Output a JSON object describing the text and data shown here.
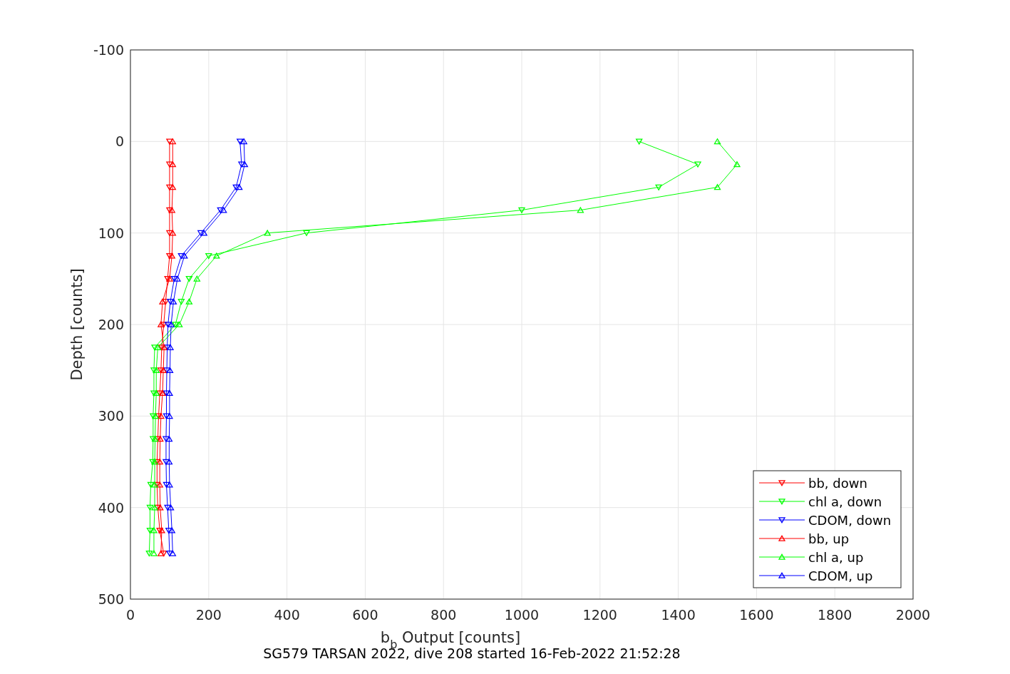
{
  "caption": "SG579 TARSAN 2022, dive 208 started 16-Feb-2022 21:52:28",
  "chart_data": {
    "type": "line",
    "orientation": "horizontal",
    "xlabel": "b$_{b}$ Output [counts]",
    "ylabel": "Depth [counts]",
    "x": [
      0,
      25,
      50,
      75,
      100,
      125,
      150,
      175,
      200,
      225,
      250,
      275,
      300,
      325,
      350,
      375,
      400,
      425,
      450
    ],
    "series": [
      {
        "name": "bb, down",
        "color": "#ff0000",
        "marker": "triangle-down",
        "values": [
          100,
          100,
          100,
          100,
          100,
          100,
          95,
          90,
          85,
          80,
          78,
          75,
          72,
          70,
          68,
          68,
          70,
          75,
          85
        ]
      },
      {
        "name": "chl a, down",
        "color": "#00ff00",
        "marker": "triangle-down",
        "values": [
          1300,
          1450,
          1350,
          1000,
          450,
          200,
          150,
          130,
          115,
          62,
          60,
          60,
          58,
          58,
          57,
          52,
          50,
          50,
          48
        ]
      },
      {
        "name": "CDOM, down",
        "color": "#0000ff",
        "marker": "triangle-down",
        "values": [
          280,
          284,
          270,
          230,
          180,
          130,
          112,
          102,
          96,
          94,
          93,
          92,
          92,
          91,
          91,
          92,
          95,
          98,
          100
        ]
      },
      {
        "name": "bb, up",
        "color": "#ff0000",
        "marker": "triangle-up",
        "values": [
          108,
          108,
          108,
          106,
          108,
          106,
          100,
          82,
          78,
          86,
          84,
          82,
          78,
          76,
          75,
          75,
          76,
          80,
          78
        ]
      },
      {
        "name": "chl a, up",
        "color": "#00ff00",
        "marker": "triangle-up",
        "values": [
          1500,
          1550,
          1500,
          1150,
          350,
          220,
          170,
          150,
          125,
          70,
          66,
          66,
          64,
          63,
          62,
          62,
          62,
          60,
          60
        ]
      },
      {
        "name": "CDOM, up",
        "color": "#0000ff",
        "marker": "triangle-up",
        "values": [
          290,
          292,
          278,
          238,
          188,
          138,
          120,
          110,
          104,
          102,
          101,
          100,
          100,
          99,
          99,
          100,
          103,
          106,
          108
        ]
      }
    ],
    "xlim": [
      0,
      2000
    ],
    "ylim": [
      500,
      -100
    ],
    "xticks": [
      0,
      200,
      400,
      600,
      800,
      1000,
      1200,
      1400,
      1600,
      1800,
      2000
    ],
    "yticks": [
      -100,
      0,
      100,
      200,
      300,
      400,
      500
    ],
    "grid": true,
    "legend": "lower right"
  }
}
